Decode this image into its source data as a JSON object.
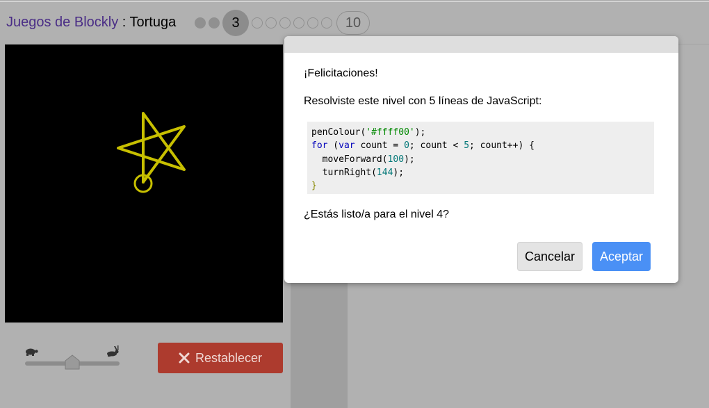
{
  "header": {
    "app_title": "Juegos de Blockly",
    "separator": " : ",
    "game_name": "Tortuga",
    "levels": {
      "completed": 2,
      "current": "3",
      "remaining_dots": 6,
      "last": "10"
    }
  },
  "canvas": {
    "background": "#000000",
    "pen_colour": "#ffff00"
  },
  "controls": {
    "speed_slow_icon": "turtle-icon",
    "speed_fast_icon": "rabbit-icon",
    "speed_value": 0.5,
    "reset_label": "Restablecer",
    "reset_icon": "close-icon"
  },
  "dialog": {
    "congrats": "¡Felicitaciones!",
    "lines_message": "Resolviste este nivel con 5 líneas de JavaScript:",
    "code": [
      "penColour('#ffff00');",
      "for (var count = 0; count < 5; count++) {",
      "  moveForward(100);",
      "  turnRight(144);",
      "}"
    ],
    "next_message": "¿Estás listo/a para el nivel 4?",
    "cancel_label": "Cancelar",
    "ok_label": "Aceptar"
  },
  "colors": {
    "accent": "#4a90f5",
    "reset": "#ad3b2e",
    "title_link": "#4a2d86"
  }
}
